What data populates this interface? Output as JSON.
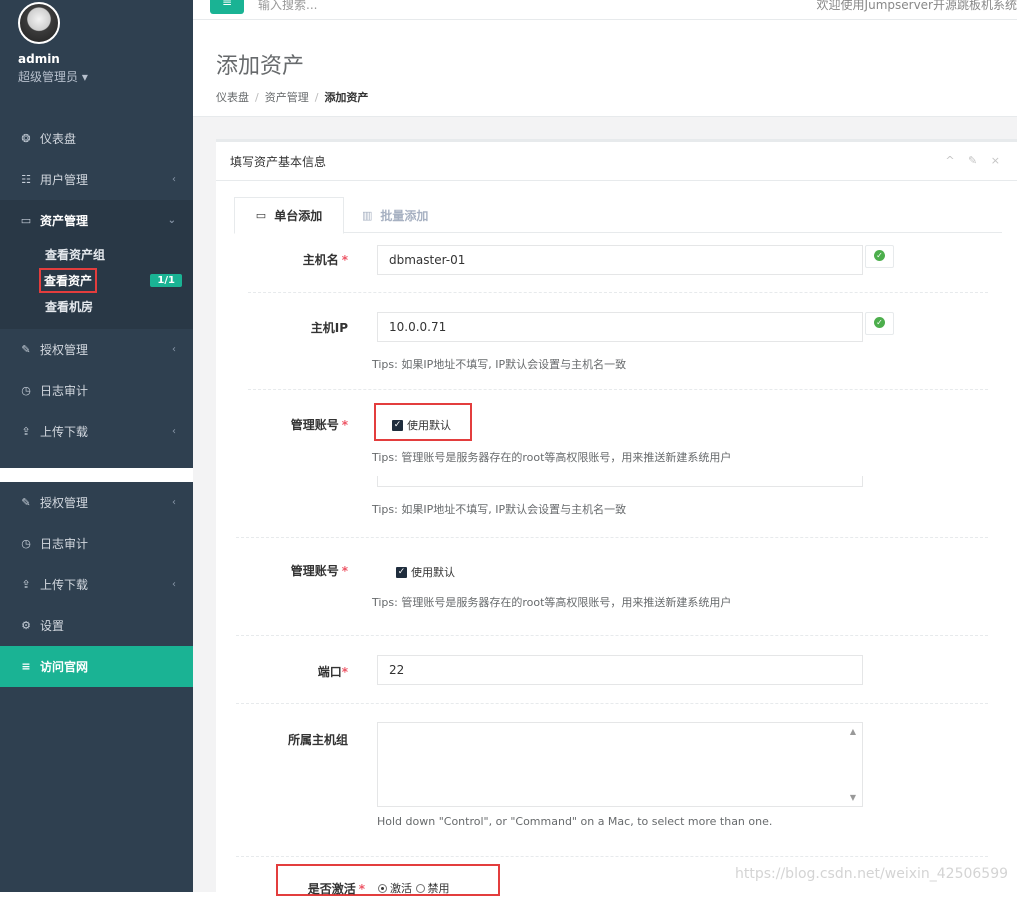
{
  "top": {
    "menu_icon": "≡",
    "search_placeholder": "输入搜索...",
    "welcome": "欢迎使用Jumpserver开源跳板机系统"
  },
  "profile": {
    "name": "admin",
    "role": "超级管理员"
  },
  "sidebar": {
    "items": [
      {
        "icon": "dashboard-icon",
        "glyph": "❂",
        "label": "仪表盘"
      },
      {
        "icon": "users-icon",
        "glyph": "☷",
        "label": "用户管理"
      },
      {
        "icon": "laptop-icon",
        "glyph": "▭",
        "label": "资产管理"
      },
      {
        "icon": "edit-icon",
        "glyph": "✎",
        "label": "授权管理"
      },
      {
        "icon": "history-icon",
        "glyph": "◷",
        "label": "日志审计"
      },
      {
        "icon": "upload-icon",
        "glyph": "⇪",
        "label": "上传下载"
      },
      {
        "icon": "gears-icon",
        "glyph": "⚙",
        "label": "设置"
      },
      {
        "icon": "database-icon",
        "glyph": "≡",
        "label": "访问官网"
      }
    ],
    "asset_sub": [
      "查看资产组",
      "查看资产",
      "查看机房"
    ],
    "asset_badge": "1/1"
  },
  "heading": {
    "title": "添加资产",
    "breadcrumb": [
      "仪表盘",
      "资产管理",
      "添加资产"
    ]
  },
  "panel": {
    "title": "填写资产基本信息",
    "tools": "^ ✎ ×",
    "tabs": [
      "单台添加",
      "批量添加"
    ]
  },
  "form": {
    "hostname_label": "主机名",
    "hostname_value": "dbmaster-01",
    "ip_label": "主机IP",
    "ip_value": "10.0.0.71",
    "ip_tips": "Tips: 如果IP地址不填写, IP默认会设置与主机名一致",
    "account_label": "管理账号",
    "account_checkbox": "使用默认",
    "account_tips": "Tips: 管理账号是服务器存在的root等高权限账号，用来推送新建系统用户",
    "port_label": "端口",
    "port_value": "22",
    "group_label": "所属主机组",
    "group_tips": "Hold down \"Control\", or \"Command\" on a Mac, to select more than one.",
    "active_label": "是否激活",
    "active_options": [
      "激活",
      "禁用"
    ]
  },
  "watermark": "https://blog.csdn.net/weixin_42506599",
  "colors": {
    "sidebar": "#2f4050",
    "accent": "#1ab394",
    "highlight": "#e33d3d",
    "required": "#ed5565"
  }
}
